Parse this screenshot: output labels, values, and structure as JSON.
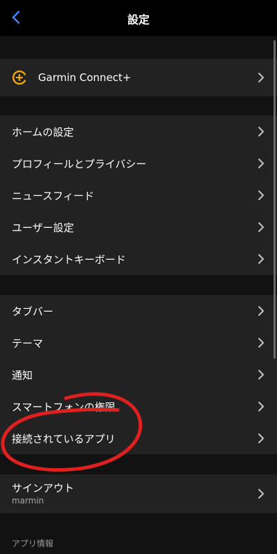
{
  "header": {
    "title": "設定",
    "back_icon": "chevron-left-icon",
    "accent": "#3b8bff"
  },
  "connect": {
    "label": "Garmin Connect+",
    "icon": "garmin-connect-plus-icon",
    "icon_color": "#f2a900"
  },
  "group1": {
    "items": [
      {
        "label": "ホームの設定"
      },
      {
        "label": "プロフィールとプライバシー"
      },
      {
        "label": "ニュースフィード"
      },
      {
        "label": "ユーザー設定"
      },
      {
        "label": "インスタントキーボード"
      }
    ]
  },
  "group2": {
    "items": [
      {
        "label": "タブバー"
      },
      {
        "label": "テーマ"
      },
      {
        "label": "通知"
      },
      {
        "label": "スマートフォンの権限"
      },
      {
        "label": "接続されているアプリ"
      }
    ]
  },
  "signout": {
    "label": "サインアウト",
    "username": "marmin"
  },
  "footer": {
    "app_info": "アプリ情報"
  },
  "annotation": {
    "color": "#e02020"
  }
}
